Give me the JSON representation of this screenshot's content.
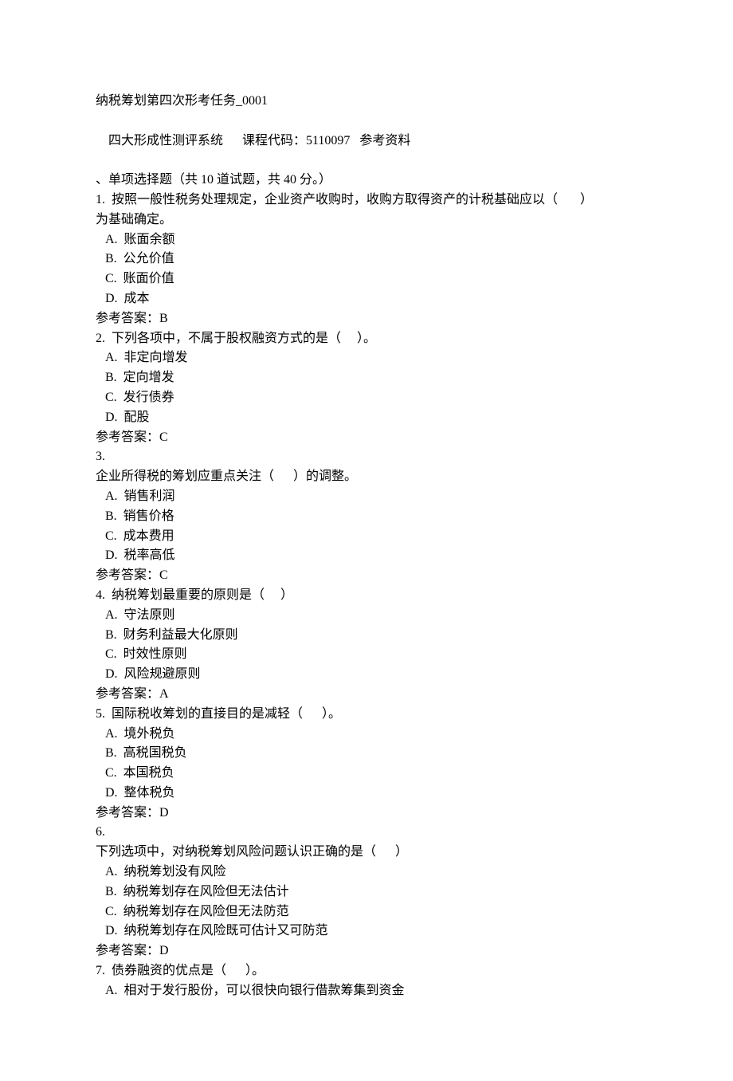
{
  "header": {
    "title": "纳税筹划第四次形考任务_0001",
    "subtitle_prefix": "四大形成性测评系统      课程代码：",
    "course_code": "5110097",
    "ref_text": "   参考资料",
    "section_title": "、单项选择题（共 10 道试题，共 40 分。）"
  },
  "questions": [
    {
      "num": "1.",
      "stem_lines": [
        "  按照一般性税务处理规定，企业资产收购时，收购方取得资产的计税基础应以（       ）",
        "为基础确定。"
      ],
      "options": [
        " A.  账面余额",
        " B.  公允价值",
        " C.  账面价值",
        " D.  成本"
      ],
      "answer": "参考答案：B"
    },
    {
      "num": "2.",
      "stem_lines": [
        "  下列各项中，不属于股权融资方式的是（     ）。"
      ],
      "options": [
        " A.  非定向增发",
        " B.  定向增发",
        " C.  发行债券",
        " D.  配股"
      ],
      "answer": "参考答案：C"
    },
    {
      "num": "3.",
      "stem_lines": [
        "企业所得税的筹划应重点关注（      ）的调整。"
      ],
      "options": [
        " A.  销售利润",
        " B.  销售价格",
        " C.  成本费用",
        " D.  税率高低"
      ],
      "answer": "参考答案：C"
    },
    {
      "num": "4.",
      "stem_lines": [
        "  纳税筹划最重要的原则是（     ）"
      ],
      "options": [
        " A.  守法原则",
        " B.  财务利益最大化原则",
        " C.  时效性原则",
        " D.  风险规避原则"
      ],
      "answer": "参考答案：A"
    },
    {
      "num": "5.",
      "stem_lines": [
        "  国际税收筹划的直接目的是减轻（      ）。"
      ],
      "options": [
        " A.  境外税负",
        " B.  高税国税负",
        " C.  本国税负",
        " D.  整体税负"
      ],
      "answer": "参考答案：D"
    },
    {
      "num": "6.",
      "stem_lines": [
        "下列选项中，对纳税筹划风险问题认识正确的是（      ）"
      ],
      "options": [
        " A.  纳税筹划没有风险",
        " B.  纳税筹划存在风险但无法估计",
        " C.  纳税筹划存在风险但无法防范",
        " D.  纳税筹划存在风险既可估计又可防范"
      ],
      "answer": "参考答案：D"
    },
    {
      "num": "7.",
      "stem_lines": [
        "  债券融资的优点是（      ）。"
      ],
      "options": [
        " A.  相对于发行股份，可以很快向银行借款筹集到资金"
      ],
      "answer": ""
    }
  ]
}
